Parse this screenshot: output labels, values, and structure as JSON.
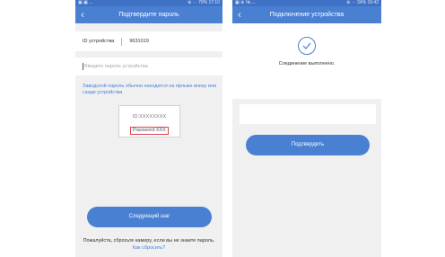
{
  "left_screen": {
    "status_bar": {
      "left": "▣ ▣ ...",
      "right": "⊛ ⋯ 70% 17:10"
    },
    "title": "Подтвердите пароль",
    "back_icon": "back-arrow",
    "device": {
      "label": "ID устройства",
      "value": "9631019"
    },
    "password": {
      "placeholder": "Введите пароль устройства",
      "value": ""
    },
    "hint": "Заводской пароль обычно находится на ярлыке внизу или сзади устройства",
    "label_card": {
      "id_text": "ID:XXXXXXXX",
      "password_text": "Password:XXX"
    },
    "next_button": "Следующий шаг",
    "footer": {
      "text": "Пожалуйста, сбросьте камеру, если вы не знаете пароль.",
      "link": "Как сбросить?"
    },
    "colors": {
      "primary": "#4a80d2",
      "highlight_border": "#d9434d"
    }
  },
  "right_screen": {
    "status_bar": {
      "left": "▣ ⊛ Чк ...",
      "right": "⊛ ⋯ 34% 16:42"
    },
    "title": "Подключение устройства",
    "back_icon": "back-arrow",
    "success_icon": "check-circle",
    "success_text": "Соединение выполнено.",
    "name_input": {
      "value": "",
      "placeholder": ""
    },
    "confirm_button": "Подтвердить"
  }
}
